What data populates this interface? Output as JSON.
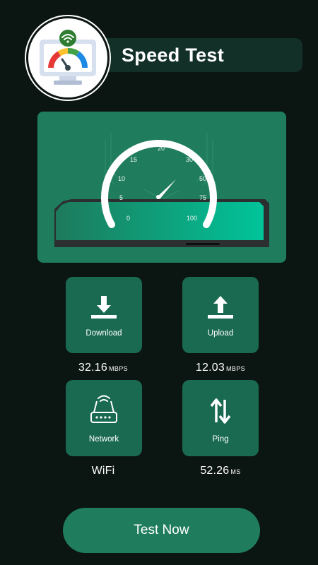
{
  "app": {
    "title": "Speed Test"
  },
  "gauge": {
    "ticks": [
      "0",
      "5",
      "10",
      "15",
      "20",
      "30",
      "50",
      "75",
      "100"
    ]
  },
  "stats": {
    "download": {
      "label": "Download",
      "value": "32.16",
      "unit": "MBPS"
    },
    "upload": {
      "label": "Upload",
      "value": "12.03",
      "unit": "MBPS"
    },
    "network": {
      "label": "Network",
      "value": "WiFi"
    },
    "ping": {
      "label": "Ping",
      "value": "52.26",
      "unit": "MS"
    }
  },
  "actions": {
    "test_now": "Test Now"
  },
  "colors": {
    "background": "#0b1512",
    "accent": "#1f7d5e",
    "tile": "#1a6a51",
    "header": "#123027"
  },
  "icons": {
    "logo": "speedometer-monitor-wifi-icon",
    "download": "download-icon",
    "upload": "upload-icon",
    "network": "router-icon",
    "ping": "up-down-arrows-icon"
  }
}
